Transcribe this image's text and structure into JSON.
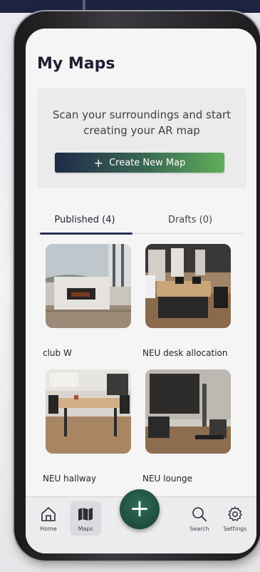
{
  "page": {
    "title": "My Maps"
  },
  "create_card": {
    "description": "Scan your surroundings and start creating your AR map",
    "button_label": "Create New Map"
  },
  "tabs": [
    {
      "label": "Published (4)",
      "active": true
    },
    {
      "label": "Drafts (0)",
      "active": false
    }
  ],
  "maps": [
    {
      "name": "club W"
    },
    {
      "name": "NEU desk allocation"
    },
    {
      "name": "NEU hallway"
    },
    {
      "name": "NEU lounge"
    }
  ],
  "fab": {
    "icon": "plus-icon"
  },
  "bottom_nav": [
    {
      "label": "Home",
      "icon": "home-icon",
      "active": false
    },
    {
      "label": "Maps",
      "icon": "map-icon",
      "active": true
    },
    {
      "label": "Search",
      "icon": "search-icon",
      "active": false
    },
    {
      "label": "Settings",
      "icon": "gear-icon",
      "active": false
    }
  ],
  "colors": {
    "title": "#1e2133",
    "button_gradient_start": "#1f2a4a",
    "button_gradient_end": "#5fae5a",
    "fab": "#1f4d3e",
    "tab_indicator": "#2b3250"
  }
}
